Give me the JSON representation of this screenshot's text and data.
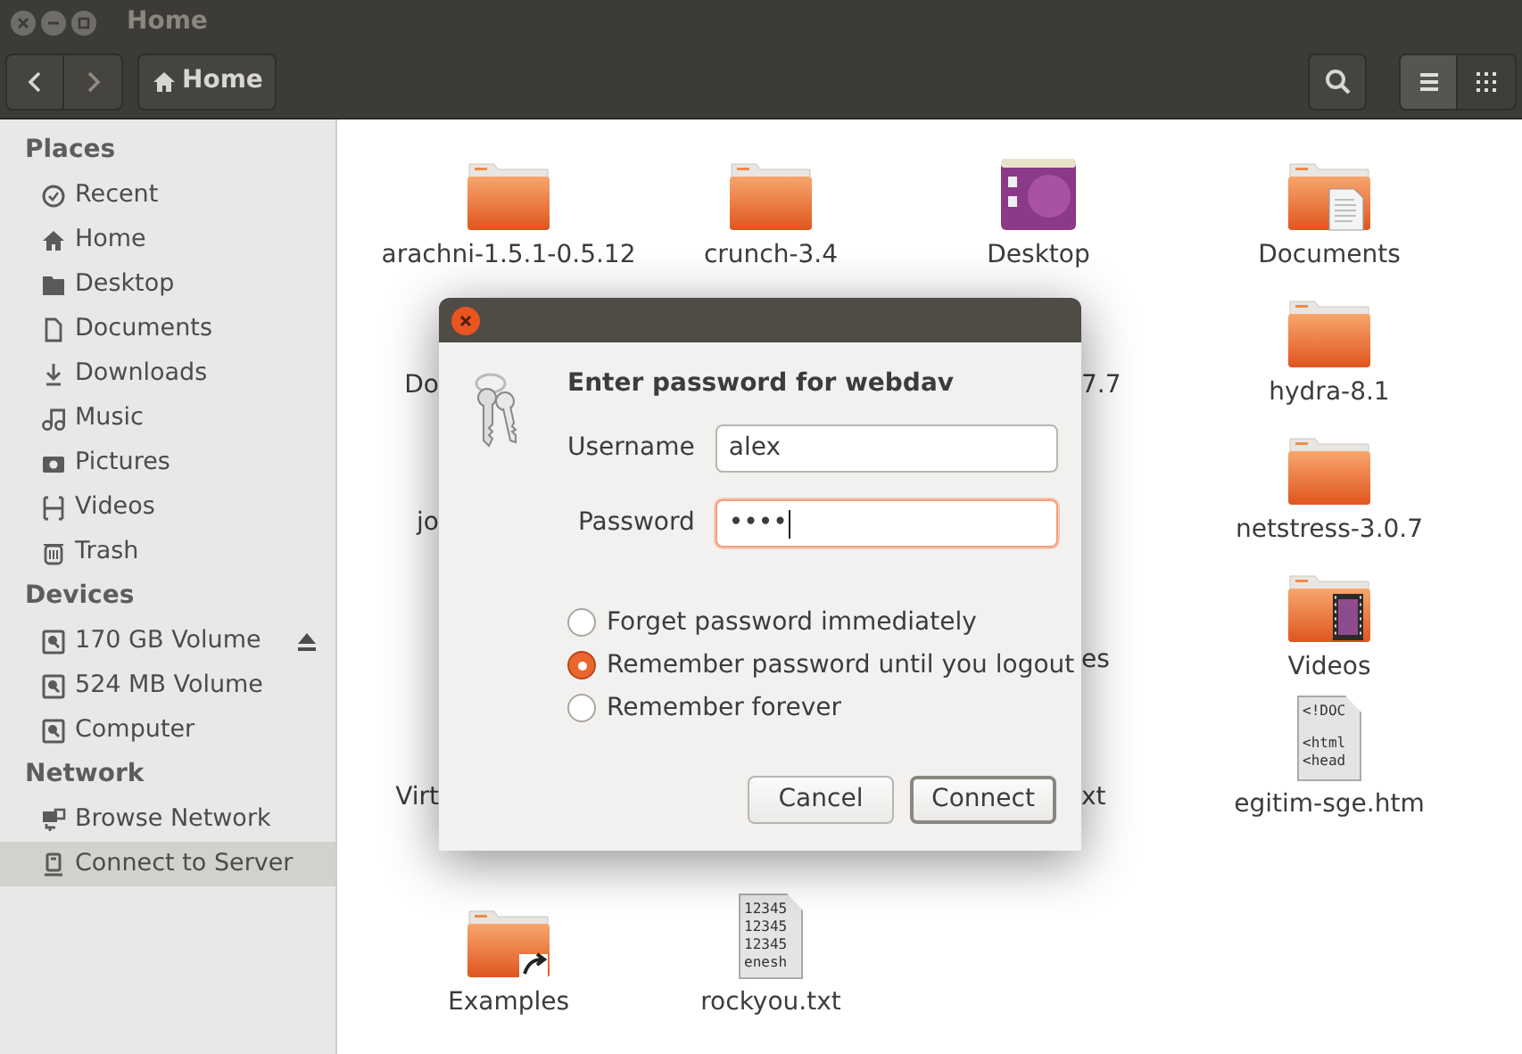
{
  "window": {
    "title": "Home"
  },
  "toolbar": {
    "location": "Home",
    "views": [
      {
        "kind": "list",
        "selected": true
      },
      {
        "kind": "grid",
        "selected": false
      }
    ]
  },
  "sidebar": {
    "sections": [
      {
        "title": "Places",
        "items": [
          {
            "label": "Recent",
            "selected": false
          },
          {
            "label": "Home",
            "selected": false
          },
          {
            "label": "Desktop",
            "selected": false
          },
          {
            "label": "Documents",
            "selected": false
          },
          {
            "label": "Downloads",
            "selected": false
          },
          {
            "label": "Music",
            "selected": false
          },
          {
            "label": "Pictures",
            "selected": false
          },
          {
            "label": "Videos",
            "selected": false
          },
          {
            "label": "Trash",
            "selected": false
          }
        ]
      },
      {
        "title": "Devices",
        "items": [
          {
            "label": "170 GB Volume",
            "selected": false,
            "eject": true
          },
          {
            "label": "524 MB Volume",
            "selected": false,
            "eject": false
          },
          {
            "label": "Computer",
            "selected": false,
            "eject": false
          }
        ]
      },
      {
        "title": "Network",
        "items": [
          {
            "label": "Browse Network",
            "selected": false
          },
          {
            "label": "Connect to Server",
            "selected": true
          }
        ]
      }
    ]
  },
  "files": [
    {
      "kind": "folder",
      "label": "arachni-1.5.1-0.5.12"
    },
    {
      "kind": "folder",
      "label": "crunch-3.4"
    },
    {
      "kind": "desktop",
      "label": "Desktop"
    },
    {
      "kind": "documents",
      "label": "Documents"
    },
    {
      "kind": "peek",
      "label": "Do"
    },
    {
      "kind": "blank"
    },
    {
      "kind": "peek",
      "label": "7.7"
    },
    {
      "kind": "folder",
      "label": "hydra-8.1"
    },
    {
      "kind": "peek",
      "label": "jo"
    },
    {
      "kind": "blank"
    },
    {
      "kind": "blank"
    },
    {
      "kind": "folder",
      "label": "netstress-3.0.7"
    },
    {
      "kind": "blank"
    },
    {
      "kind": "blank"
    },
    {
      "kind": "peek",
      "label": "es"
    },
    {
      "kind": "videos",
      "label": "Videos"
    },
    {
      "kind": "peek",
      "label": "Virt"
    },
    {
      "kind": "blank"
    },
    {
      "kind": "peek",
      "label": "xt"
    },
    {
      "kind": "html",
      "label": "egitim-sge.htm",
      "preview": [
        "<!DOC",
        "<html",
        "<head"
      ]
    },
    {
      "kind": "link",
      "label": "Examples"
    },
    {
      "kind": "text",
      "label": "rockyou.txt",
      "preview": [
        "12345",
        "12345",
        "12345",
        "enesh"
      ]
    },
    {
      "kind": "blank"
    },
    {
      "kind": "blank"
    }
  ],
  "dialog": {
    "title": "Enter password for webdav",
    "fields": [
      {
        "label": "Username",
        "value": "alex",
        "focused": false
      },
      {
        "label": "Password",
        "value": "••••",
        "focused": true
      }
    ],
    "options": [
      {
        "label": "Forget password immediately",
        "selected": false
      },
      {
        "label": "Remember password until you logout",
        "selected": true
      },
      {
        "label": "Remember forever",
        "selected": false
      }
    ],
    "buttons": [
      {
        "label": "Cancel",
        "default": false
      },
      {
        "label": "Connect",
        "default": true
      }
    ]
  }
}
